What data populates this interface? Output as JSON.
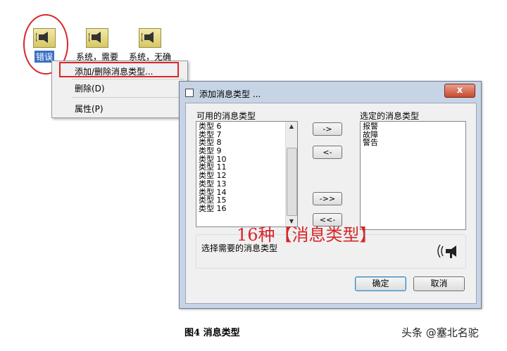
{
  "desktop": {
    "icons": [
      {
        "label": "错误",
        "selected": true
      },
      {
        "label": "系统，需要",
        "selected": false
      },
      {
        "label": "系统，无确",
        "selected": false
      }
    ]
  },
  "context_menu": {
    "items": [
      "添加/删除消息类型...",
      "删除(D)",
      "属性(P)"
    ]
  },
  "dialog": {
    "title": "添加消息类型 ...",
    "close_label": "x",
    "available_label": "可用的消息类型",
    "selected_label": "选定的消息类型",
    "available_items": [
      "类型 6",
      "类型 7",
      "类型 8",
      "类型 9",
      "类型 10",
      "类型 11",
      "类型 12",
      "类型 13",
      "类型 14",
      "类型 15",
      "类型 16"
    ],
    "selected_items": [
      "报警",
      "故障",
      "警告"
    ],
    "move_right": "->",
    "move_left": "<-",
    "move_all_right": "->>",
    "move_all_left": "<<-",
    "description": "选择需要的消息类型",
    "ok_button": "确定",
    "cancel_button": "取消"
  },
  "annotation": "16种【消息类型】",
  "caption": "图4  消息类型",
  "watermark": "头条 @塞北名驼",
  "colors": {
    "highlight": "#d6262a",
    "selection": "#3a6fc3"
  }
}
